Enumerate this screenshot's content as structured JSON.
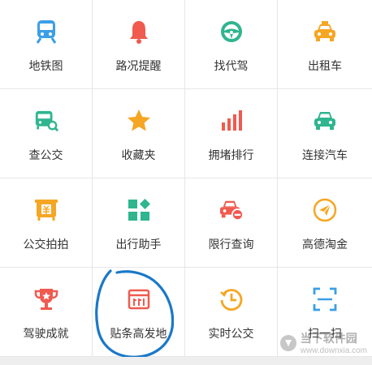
{
  "grid": {
    "items": [
      {
        "label": "地铁图",
        "icon": "subway-icon",
        "color": "#3b9fe6"
      },
      {
        "label": "路况提醒",
        "icon": "bell-icon",
        "color": "#f05a4f"
      },
      {
        "label": "找代驾",
        "icon": "steering-wheel-icon",
        "color": "#2fb58f"
      },
      {
        "label": "出租车",
        "icon": "taxi-icon",
        "color": "#f5a623"
      },
      {
        "label": "查公交",
        "icon": "bus-search-icon",
        "color": "#2fb58f"
      },
      {
        "label": "收藏夹",
        "icon": "star-icon",
        "color": "#f5a623"
      },
      {
        "label": "拥堵排行",
        "icon": "bar-chart-icon",
        "color": "#f05a4f"
      },
      {
        "label": "连接汽车",
        "icon": "car-icon",
        "color": "#2fb58f"
      },
      {
        "label": "公交拍拍",
        "icon": "bus-ticket-icon",
        "color": "#f5a623"
      },
      {
        "label": "出行助手",
        "icon": "apps-icon",
        "color": "#2fb58f"
      },
      {
        "label": "限行查询",
        "icon": "car-restrict-icon",
        "color": "#f05a4f"
      },
      {
        "label": "高德淘金",
        "icon": "paper-plane-icon",
        "color": "#f5a623"
      },
      {
        "label": "驾驶成就",
        "icon": "trophy-icon",
        "color": "#f05a4f"
      },
      {
        "label": "贴条高发地",
        "icon": "ticket-icon",
        "color": "#f05a4f"
      },
      {
        "label": "实时公交",
        "icon": "clock-icon",
        "color": "#f5a623"
      },
      {
        "label": "扫一扫",
        "icon": "scan-icon",
        "color": "#3b9fe6"
      }
    ]
  },
  "watermark": {
    "cn": "当下软件园",
    "url": "www.downxia.com"
  }
}
